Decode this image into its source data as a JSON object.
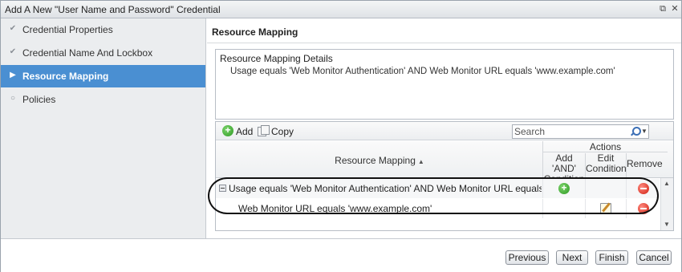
{
  "window": {
    "title": "Add A New \"User Name and Password\" Credential",
    "restore_glyph": "⧉",
    "close_glyph": "✕"
  },
  "sidebar": {
    "items": [
      {
        "label": "Credential Properties",
        "state": "done",
        "glyph": "✔"
      },
      {
        "label": "Credential Name And Lockbox",
        "state": "done",
        "glyph": "✔"
      },
      {
        "label": "Resource Mapping",
        "state": "active",
        "glyph": "▶"
      },
      {
        "label": "Policies",
        "state": "pending",
        "glyph": "○"
      }
    ]
  },
  "main": {
    "heading": "Resource Mapping",
    "details": {
      "title": "Resource Mapping Details",
      "text": "Usage equals 'Web Monitor Authentication' AND Web Monitor URL equals 'www.example.com'"
    },
    "toolbar": {
      "add_label": "Add",
      "copy_label": "Copy",
      "search_placeholder": "Search"
    },
    "grid": {
      "columns": {
        "mapping": "Resource Mapping",
        "sort_glyph": "▲",
        "actions": "Actions",
        "add_and": [
          "Add 'AND'",
          "Condition"
        ],
        "edit": [
          "Edit",
          "Condition"
        ],
        "remove": "Remove"
      },
      "rows": [
        {
          "text": "Usage equals 'Web Monitor Authentication' AND Web Monitor URL equals 'www.e",
          "level": 0,
          "add": true,
          "edit": false,
          "remove": true
        },
        {
          "text": "Web Monitor URL equals 'www.example.com'",
          "level": 1,
          "add": false,
          "edit": true,
          "remove": true
        }
      ]
    }
  },
  "footer": {
    "previous": "Previous",
    "next": "Next",
    "finish": "Finish",
    "cancel": "Cancel"
  },
  "colors": {
    "active_step": "#4a8fd2",
    "add_green": "#2f9a24",
    "remove_red": "#d01f10"
  }
}
